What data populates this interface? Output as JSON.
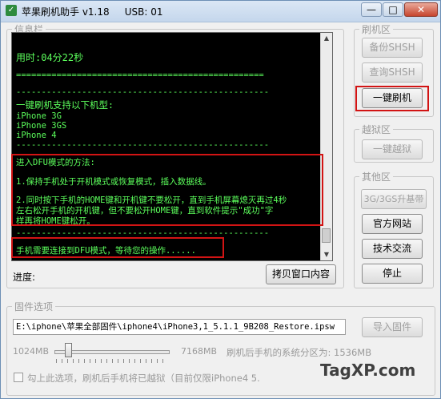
{
  "window": {
    "title": "苹果刷机助手 v1.18     USB: 01",
    "minimize": "—",
    "maximize": "□",
    "close": "✕"
  },
  "info_group": {
    "legend": "信息栏"
  },
  "console": {
    "lines": [
      "用时:04分22秒",
      "=================================================",
      "--------------------------------------------------",
      "一键刷机支持以下机型:",
      "iPhone 3G",
      "iPhone 3GS",
      "iPhone 4",
      "--------------------------------------------------",
      "进入DFU模式的方法:",
      "1.保持手机处于开机模式或恢复模式，插入数据线。",
      "2.同时按下手机的HOME键和开机键不要松开，直到手机屏幕熄灭再过4秒",
      "左右松开手机的开机键，但不要松开HOME键，直到软件提示\"成功\"字",
      "样再将HOME键松开。",
      "--------------------------------------------------",
      "手机需要连接到DFU模式，等待您的操作......"
    ]
  },
  "progress": {
    "label": "进度:",
    "copy_button": "拷贝窗口内容"
  },
  "flash_group": {
    "legend": "刷机区",
    "backup_shsh": "备份SHSH",
    "query_shsh": "查询SHSH",
    "one_click_flash": "一键刷机"
  },
  "jailbreak_group": {
    "legend": "越狱区",
    "one_click_jailbreak": "一键越狱"
  },
  "other_group": {
    "legend": "其他区",
    "upgrade_baseband": "3G/3GS升基带",
    "official_site": "官方网站",
    "tech_exchange": "技术交流",
    "stop": "停止"
  },
  "firmware_group": {
    "legend": "固件选项",
    "path": "E:\\iphone\\苹果全部固件\\iphone4\\iPhone3,1_5.1.1_9B208_Restore.ipsw",
    "import_button": "导入固件",
    "min_label": "1024MB",
    "max_label": "7168MB",
    "partition_text": "刷机后手机的系统分区为: 1536MB",
    "checkbox_text": "勾上此选项，刷机后手机将已越狱（目前仅限iPhone4 5.",
    "slider_value_mb": 1536
  },
  "watermark": {
    "text": "TagXP.com"
  }
}
